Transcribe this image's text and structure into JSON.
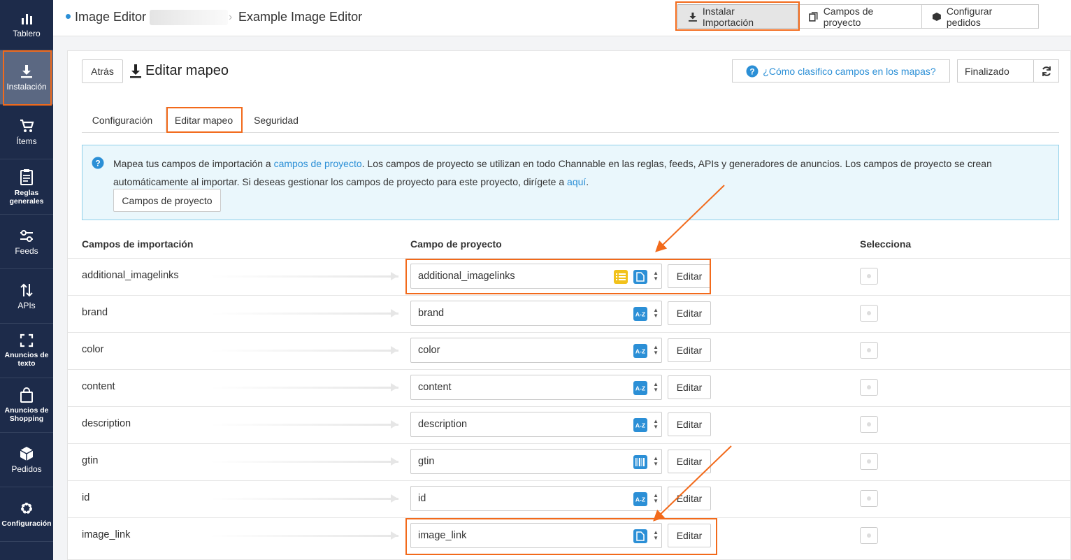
{
  "sidebar": {
    "items": [
      {
        "label": "Tablero",
        "icon": "bar-chart-icon"
      },
      {
        "label": "Instalación",
        "icon": "download-icon",
        "active": true
      },
      {
        "label": "Ítems",
        "icon": "cart-icon"
      },
      {
        "label": "Reglas generales",
        "icon": "clipboard-icon"
      },
      {
        "label": "Feeds",
        "icon": "sliders-icon"
      },
      {
        "label": "APIs",
        "icon": "swap-vertical-icon"
      },
      {
        "label": "Anuncios de texto",
        "icon": "frame-icon"
      },
      {
        "label": "Anuncios de Shopping",
        "icon": "shopping-bag-icon"
      },
      {
        "label": "Pedidos",
        "icon": "box-icon"
      },
      {
        "label": "Configuración",
        "icon": "gear-icon"
      }
    ]
  },
  "topbar": {
    "crumb1": "Image Editor",
    "crumb3": "Example Image Editor",
    "buttons": [
      "Instalar Importación",
      "Campos de proyecto",
      "Configurar pedidos"
    ]
  },
  "header": {
    "back": "Atrás",
    "title": "Editar mapeo",
    "help": "¿Cómo clasifico campos en los mapas?",
    "status": "Finalizado"
  },
  "tabs": [
    "Configuración",
    "Editar mapeo",
    "Seguridad"
  ],
  "info": {
    "t1": "Mapea tus campos de importación a ",
    "link1": "campos de proyecto",
    "t2": ". Los campos de proyecto se utilizan en todo Channable en las reglas, feeds, APIs y generadores de anuncios. Los campos de proyecto se crean automáticamente al importar. Si deseas gestionar los campos de proyecto para este proyecto, dirígete a ",
    "link2": "aquí",
    "t3": ".",
    "button": "Campos de proyecto"
  },
  "table": {
    "headers": [
      "Campos de importación",
      "Campo de proyecto",
      "Selecciona"
    ],
    "edit_label": "Editar",
    "rows": [
      {
        "import": "additional_imagelinks",
        "project": "additional_imagelinks",
        "icons": [
          "list-icon",
          "file-icon"
        ]
      },
      {
        "import": "brand",
        "project": "brand",
        "icons": [
          "az-icon"
        ]
      },
      {
        "import": "color",
        "project": "color",
        "icons": [
          "az-icon"
        ]
      },
      {
        "import": "content",
        "project": "content",
        "icons": [
          "az-icon"
        ]
      },
      {
        "import": "description",
        "project": "description",
        "icons": [
          "az-icon"
        ]
      },
      {
        "import": "gtin",
        "project": "gtin",
        "icons": [
          "barcode-icon"
        ]
      },
      {
        "import": "id",
        "project": "id",
        "icons": [
          "az-icon"
        ]
      },
      {
        "import": "image_link",
        "project": "image_link",
        "icons": [
          "file-icon"
        ]
      }
    ]
  },
  "colors": {
    "sidebar": "#1d2b4a",
    "accent": "#2b8fd6",
    "highlight": "#f26a1b",
    "list_icon": "#f2c21b"
  }
}
